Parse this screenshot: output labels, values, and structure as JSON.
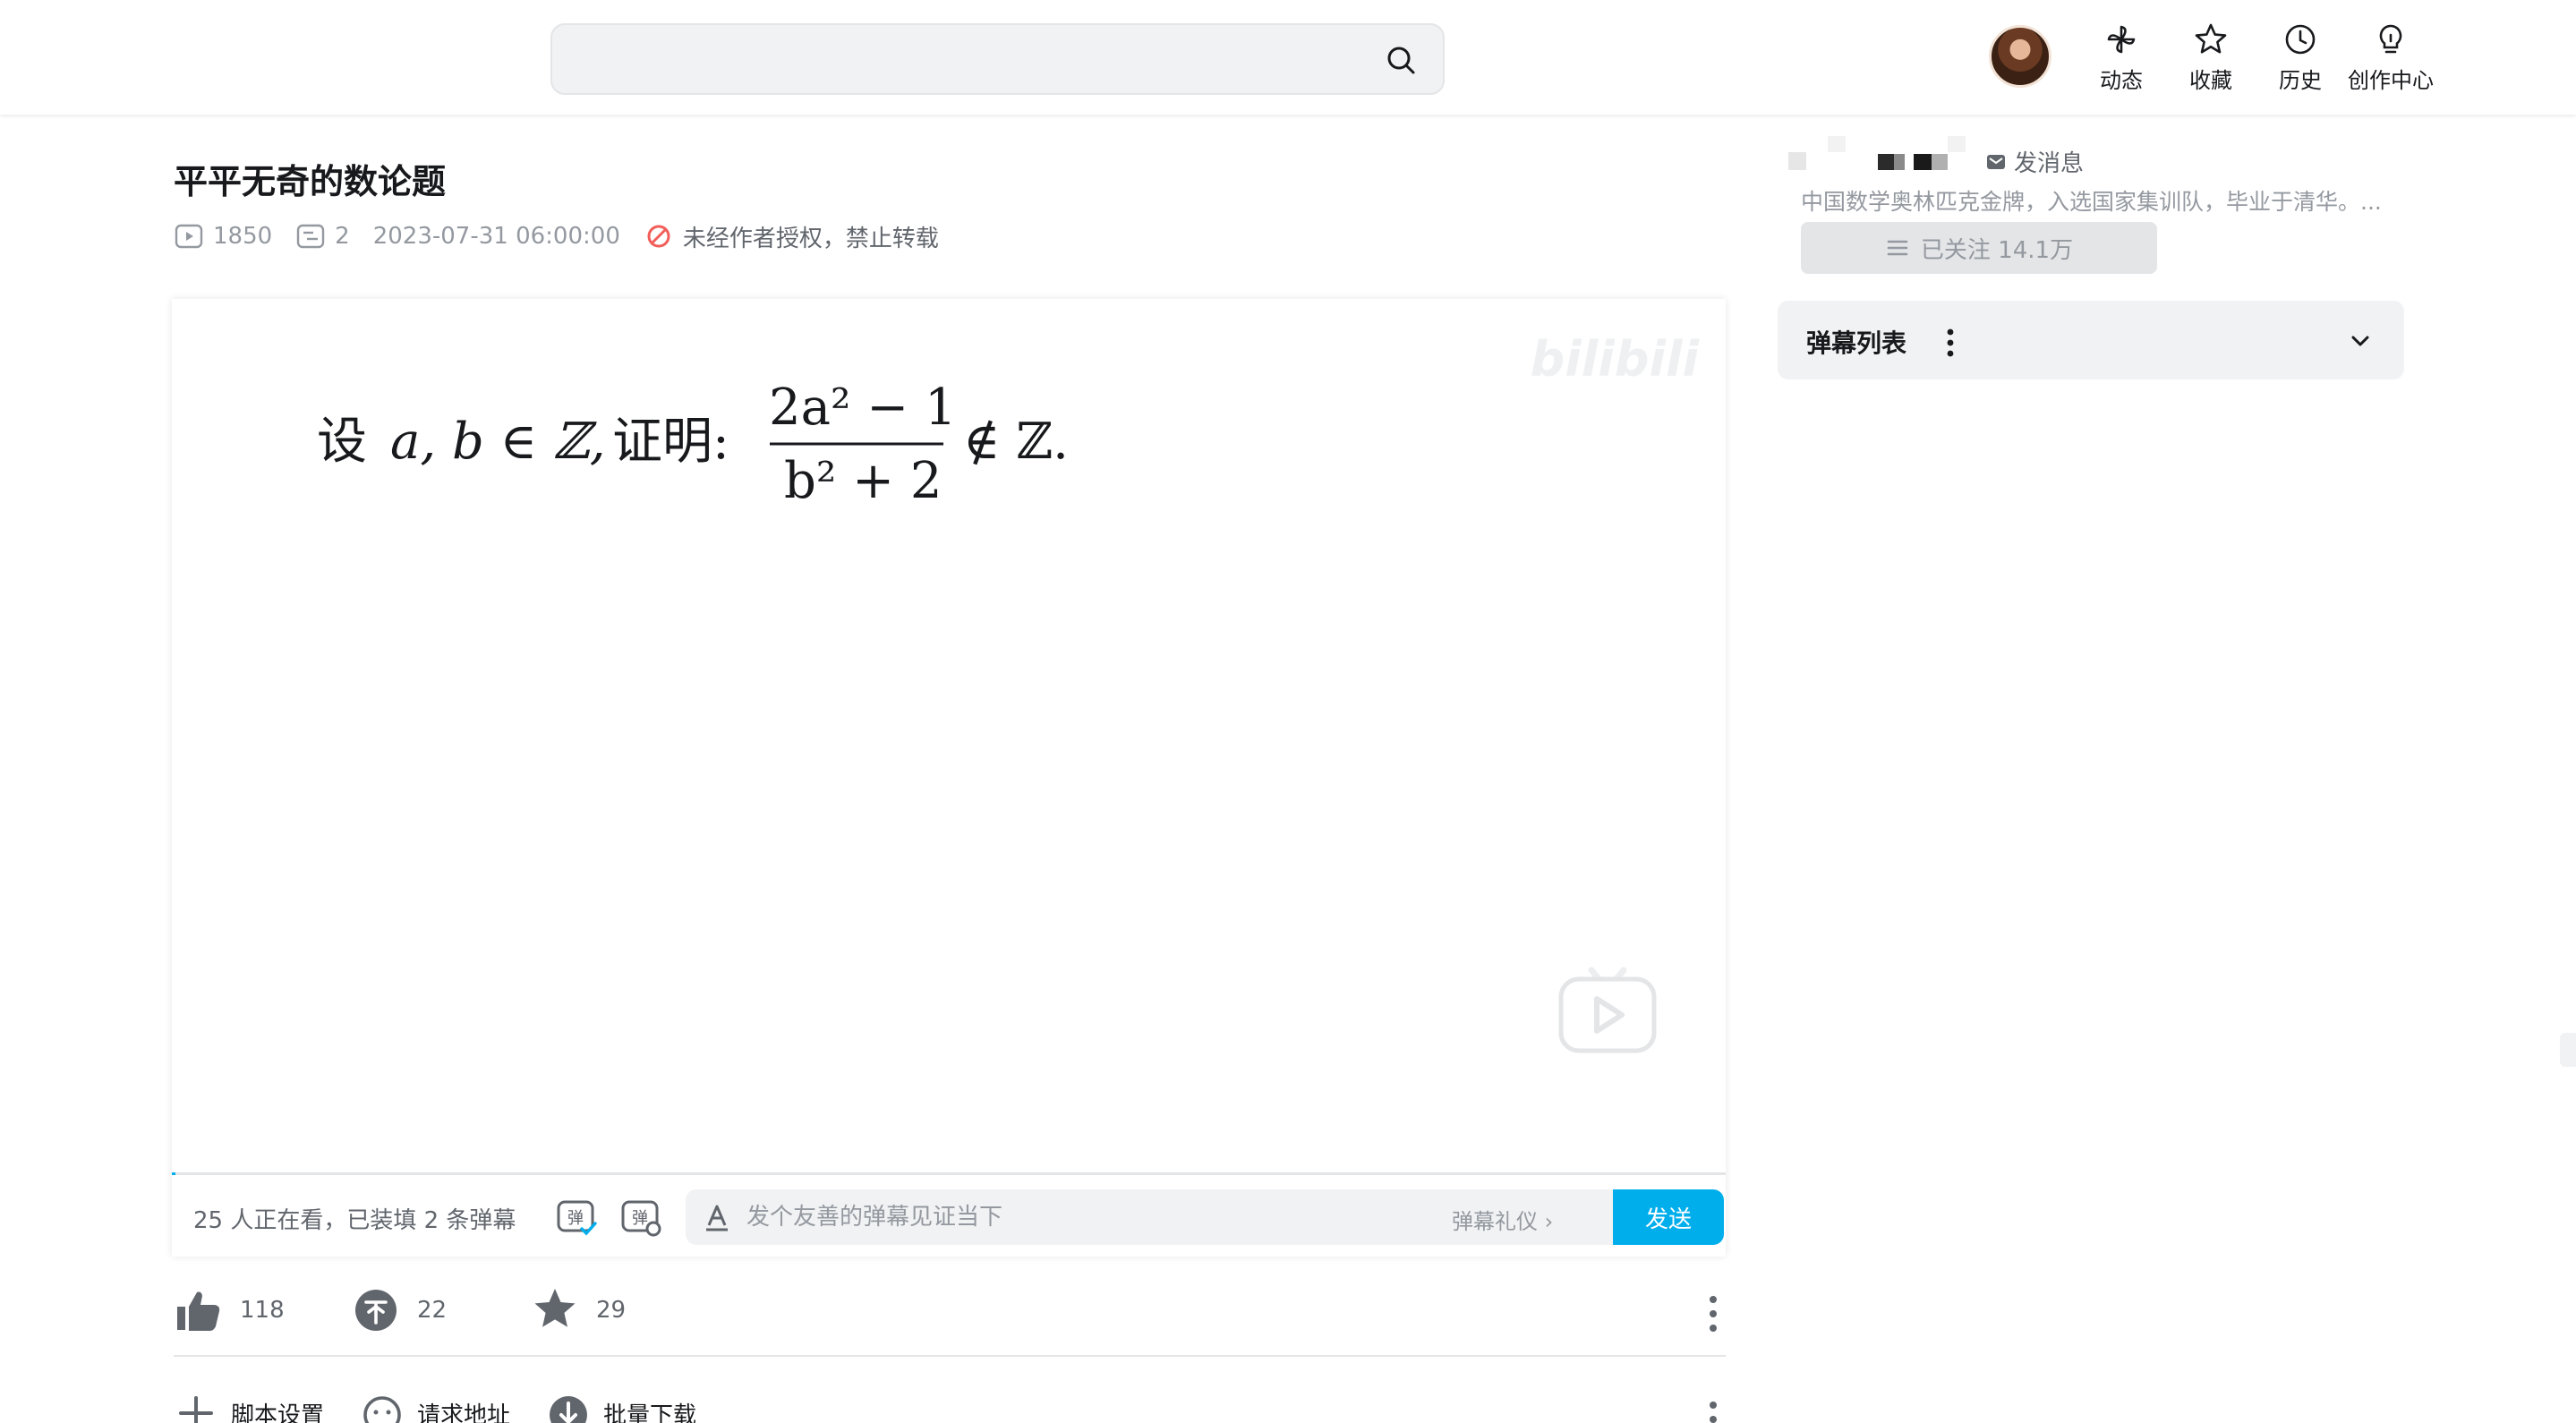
{
  "search": {
    "placeholder": ""
  },
  "nav": [
    {
      "label": "动态",
      "icon": "pinwheel-icon"
    },
    {
      "label": "收藏",
      "icon": "star-icon"
    },
    {
      "label": "历史",
      "icon": "clock-icon"
    },
    {
      "label": "创作中心",
      "icon": "lightbulb-icon"
    }
  ],
  "video": {
    "title": "平平无奇的数论题",
    "views": "1850",
    "danmaku_count": "2",
    "date": "2023-07-31 06:00:00",
    "copyright": "未经作者授权，禁止转载",
    "formula": {
      "lead": "设",
      "condition": "a, b ∈ ℤ,",
      "prove": "证明:",
      "numerator": "2a² − 1",
      "denominator": "b² + 2",
      "conclusion": "∉ ℤ."
    },
    "watermark": "bilibili"
  },
  "sendbar": {
    "watching": "25 人正在看，已装填 2 条弹幕",
    "placeholder": "发个友善的弹幕见证当下",
    "etiquette": "弹幕礼仪 ›",
    "send": "发送"
  },
  "actions": {
    "likes": "118",
    "coins": "22",
    "favorites": "29"
  },
  "script_bar": {
    "settings": "脚本设置",
    "request_url": "请求地址",
    "batch_download": "批量下载"
  },
  "uploader": {
    "message": "发消息",
    "description": "中国数学奥林匹克金牌，入选国家集训队，毕业于清华。...",
    "follow": "已关注 14.1万"
  },
  "danmaku_list": {
    "label": "弹幕列表"
  },
  "colors": {
    "accent": "#00aeec",
    "text": "#18191c",
    "muted": "#9499a0",
    "panel": "#f1f2f3"
  }
}
